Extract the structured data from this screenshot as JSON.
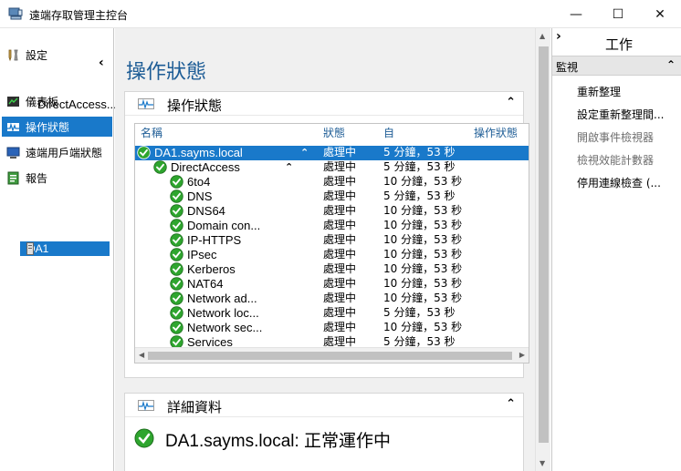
{
  "window": {
    "title": "遠端存取管理主控台",
    "minimize_glyph": "—",
    "maximize_glyph": "☐",
    "close_glyph": "✕"
  },
  "left_nav": {
    "collapse_glyph": "‹",
    "items": [
      {
        "label": "設定",
        "icon": "wrench-icon"
      },
      {
        "label": "儀表板",
        "icon": "dashboard-icon"
      },
      {
        "label": "操作狀態",
        "icon": "pulse-icon",
        "selected": true
      },
      {
        "label": "遠端用戶端狀態",
        "icon": "computer-icon"
      },
      {
        "label": "報告",
        "icon": "report-icon"
      }
    ],
    "sub_label": "DirectAccess...",
    "server": "DA1"
  },
  "main": {
    "page_title": "操作狀態",
    "status_panel": {
      "title": "操作狀態",
      "columns": [
        "名稱",
        "狀態",
        "自",
        "操作狀態"
      ],
      "rows": [
        {
          "name": "DA1.sayms.local",
          "status": "處理中",
          "since": "5 分鐘，53 秒",
          "level": 0,
          "expanded": true,
          "selected": true
        },
        {
          "name": "DirectAccess",
          "status": "處理中",
          "since": "5 分鐘，53 秒",
          "level": 1,
          "expanded": true
        },
        {
          "name": "6to4",
          "status": "處理中",
          "since": "10 分鐘，53 秒",
          "level": 2
        },
        {
          "name": "DNS",
          "status": "處理中",
          "since": "5 分鐘，53 秒",
          "level": 2
        },
        {
          "name": "DNS64",
          "status": "處理中",
          "since": "10 分鐘，53 秒",
          "level": 2
        },
        {
          "name": "Domain con...",
          "status": "處理中",
          "since": "10 分鐘，53 秒",
          "level": 2
        },
        {
          "name": "IP-HTTPS",
          "status": "處理中",
          "since": "10 分鐘，53 秒",
          "level": 2
        },
        {
          "name": "IPsec",
          "status": "處理中",
          "since": "10 分鐘，53 秒",
          "level": 2
        },
        {
          "name": "Kerberos",
          "status": "處理中",
          "since": "10 分鐘，53 秒",
          "level": 2
        },
        {
          "name": "NAT64",
          "status": "處理中",
          "since": "10 分鐘，53 秒",
          "level": 2
        },
        {
          "name": "Network ad...",
          "status": "處理中",
          "since": "10 分鐘，53 秒",
          "level": 2
        },
        {
          "name": "Network loc...",
          "status": "處理中",
          "since": "5 分鐘，53 秒",
          "level": 2
        },
        {
          "name": "Network sec...",
          "status": "處理中",
          "since": "10 分鐘，53 秒",
          "level": 2
        },
        {
          "name": "Services",
          "status": "處理中",
          "since": "5 分鐘，53 秒",
          "level": 2
        }
      ]
    },
    "detail_panel": {
      "title": "詳細資料",
      "text": "DA1.sayms.local: 正常運作中"
    }
  },
  "actions_pane": {
    "title": "工作",
    "expand_glyph": "›",
    "section": "監視",
    "items": [
      {
        "label": "重新整理",
        "enabled": true
      },
      {
        "label": "設定重新整理間...",
        "enabled": true
      },
      {
        "label": "開啟事件檢視器",
        "enabled": false
      },
      {
        "label": "檢視效能計數器",
        "enabled": false
      },
      {
        "label": "停用連線檢查 (...",
        "enabled": true
      }
    ]
  },
  "colors": {
    "selection": "#1979ca",
    "heading_blue": "#1e5d96",
    "status_ok": "#2ea52e",
    "disabled_text": "#6d6d6d"
  }
}
